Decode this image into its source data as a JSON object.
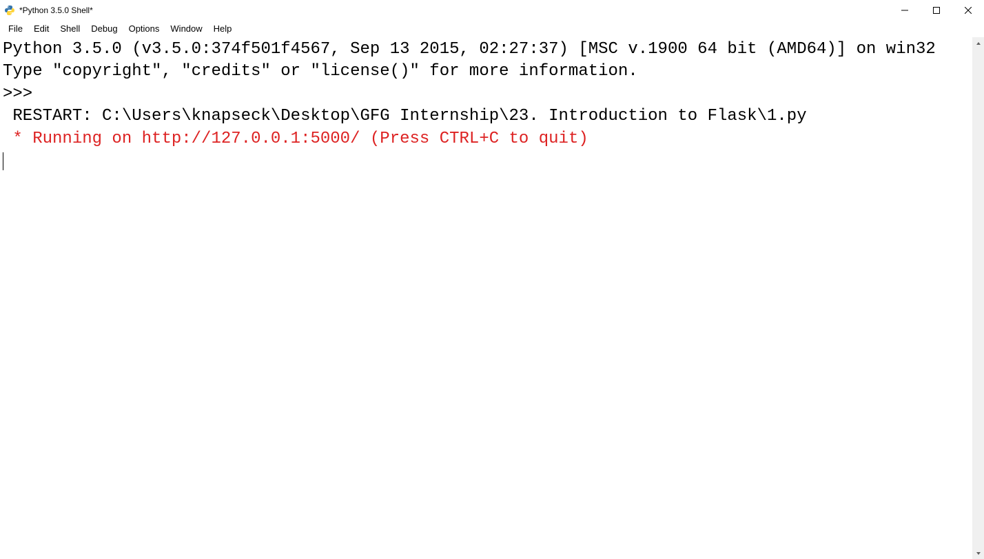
{
  "window": {
    "title": "*Python 3.5.0 Shell*"
  },
  "menu": {
    "file": "File",
    "edit": "Edit",
    "shell": "Shell",
    "debug": "Debug",
    "options": "Options",
    "window": "Window",
    "help": "Help"
  },
  "shell": {
    "line1": "Python 3.5.0 (v3.5.0:374f501f4567, Sep 13 2015, 02:27:37) [MSC v.1900 64 bit (AMD64)] on win32",
    "line2": "Type \"copyright\", \"credits\" or \"license()\" for more information.",
    "prompt": ">>> ",
    "restart_line": " RESTART: C:\\Users\\knapseck\\Desktop\\GFG Internship\\23. Introduction to Flask\\1.py ",
    "running_line": " * Running on http://127.0.0.1:5000/ (Press CTRL+C to quit)"
  }
}
